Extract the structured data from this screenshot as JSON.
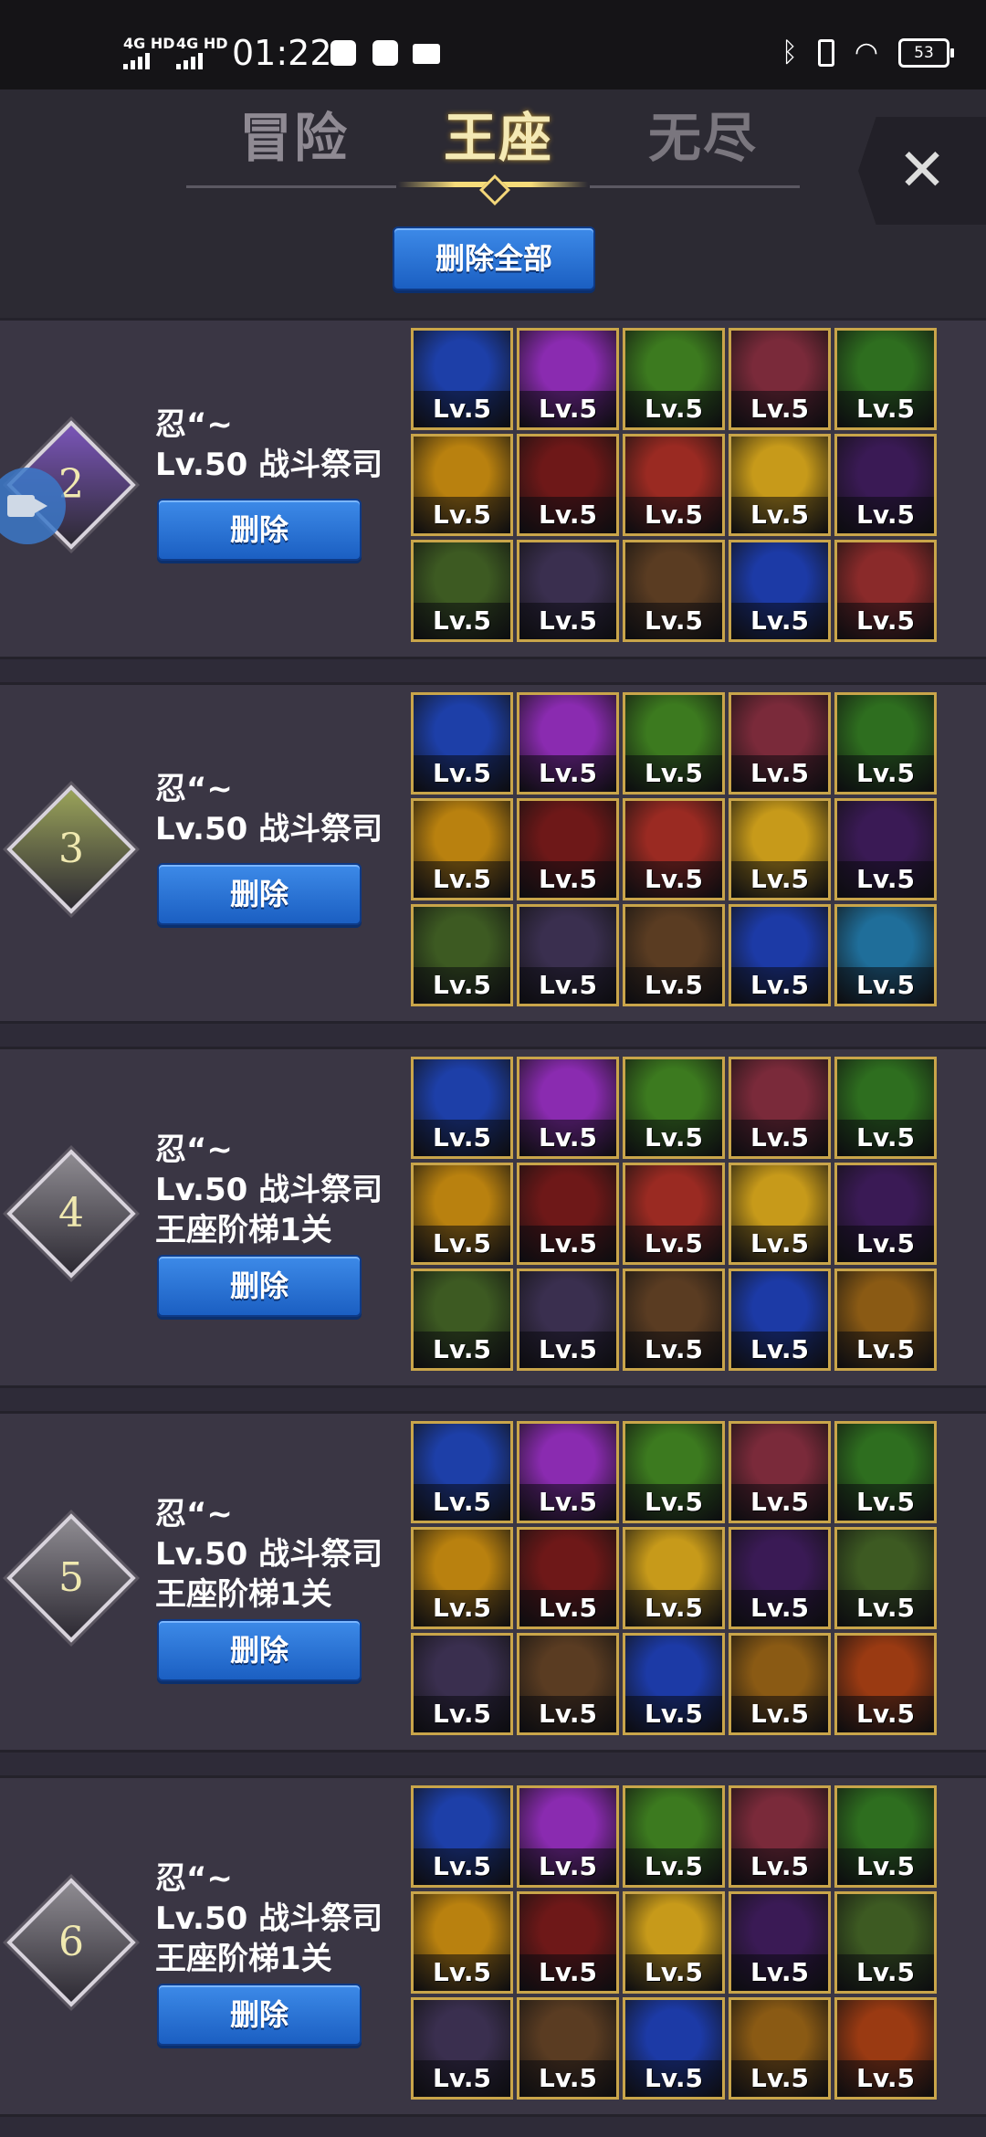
{
  "status_bar": {
    "net1": "4G HD",
    "net2": "4G HD",
    "time": "01:22",
    "battery": "53"
  },
  "header": {
    "tabs": [
      {
        "label": "冒险",
        "active": false
      },
      {
        "label": "王座",
        "active": true
      },
      {
        "label": "无尽",
        "active": false
      }
    ],
    "close_label": "✕",
    "delete_all_label": "删除全部"
  },
  "rows": [
    {
      "rank": "2",
      "rank_color": "#7a55b8",
      "name": "忍“~",
      "level_class": "Lv.50 战斗祭司",
      "stage": "",
      "delete_label": "删除",
      "skills": [
        "Lv.5",
        "Lv.5",
        "Lv.5",
        "Lv.5",
        "Lv.5",
        "Lv.5",
        "Lv.5",
        "Lv.5",
        "Lv.5",
        "Lv.5",
        "Lv.5",
        "Lv.5",
        "Lv.5",
        "Lv.5",
        "Lv.5"
      ],
      "skill_icons": [
        "#1d3fa8",
        "#8a2bb0",
        "#3c7a1f",
        "#7a2a3a",
        "#2e6e1f",
        "#b9810f",
        "#6e1818",
        "#9a2a22",
        "#c79a1a",
        "#3a1a55",
        "#3d5a22",
        "#3a2f4f",
        "#5a3c22",
        "#1c3aa6",
        "#8a2a2a"
      ]
    },
    {
      "rank": "3",
      "rank_color": "#9aa35a",
      "name": "忍“~",
      "level_class": "Lv.50 战斗祭司",
      "stage": "",
      "delete_label": "删除",
      "skills": [
        "Lv.5",
        "Lv.5",
        "Lv.5",
        "Lv.5",
        "Lv.5",
        "Lv.5",
        "Lv.5",
        "Lv.5",
        "Lv.5",
        "Lv.5",
        "Lv.5",
        "Lv.5",
        "Lv.5",
        "Lv.5",
        "Lv.5"
      ],
      "skill_icons": [
        "#1d3fa8",
        "#8a2bb0",
        "#3c7a1f",
        "#7a2a3a",
        "#2e6e1f",
        "#b9810f",
        "#6e1818",
        "#9a2a22",
        "#c79a1a",
        "#3a1a55",
        "#3d5a22",
        "#3a2f4f",
        "#5a3c22",
        "#1c3aa6",
        "#1f6e9a"
      ]
    },
    {
      "rank": "4",
      "rank_color": "#8e8b91",
      "name": "忍“~",
      "level_class": "Lv.50 战斗祭司",
      "stage": "王座阶梯1关",
      "delete_label": "删除",
      "skills": [
        "Lv.5",
        "Lv.5",
        "Lv.5",
        "Lv.5",
        "Lv.5",
        "Lv.5",
        "Lv.5",
        "Lv.5",
        "Lv.5",
        "Lv.5",
        "Lv.5",
        "Lv.5",
        "Lv.5",
        "Lv.5",
        "Lv.5"
      ],
      "skill_icons": [
        "#1d3fa8",
        "#8a2bb0",
        "#3c7a1f",
        "#7a2a3a",
        "#2e6e1f",
        "#b9810f",
        "#6e1818",
        "#9a2a22",
        "#c79a1a",
        "#3a1a55",
        "#3d5a22",
        "#3a2f4f",
        "#5a3c22",
        "#1c3aa6",
        "#8a5a14"
      ]
    },
    {
      "rank": "5",
      "rank_color": "#8e8b91",
      "name": "忍“~",
      "level_class": "Lv.50 战斗祭司",
      "stage": "王座阶梯1关",
      "delete_label": "删除",
      "skills": [
        "Lv.5",
        "Lv.5",
        "Lv.5",
        "Lv.5",
        "Lv.5",
        "Lv.5",
        "Lv.5",
        "Lv.5",
        "Lv.5",
        "Lv.5",
        "Lv.5",
        "Lv.5",
        "Lv.5",
        "Lv.5",
        "Lv.5"
      ],
      "skill_icons": [
        "#1d3fa8",
        "#8a2bb0",
        "#3c7a1f",
        "#7a2a3a",
        "#2e6e1f",
        "#b9810f",
        "#6e1818",
        "#c79a1a",
        "#3a1a55",
        "#3d5a22",
        "#3a2f4f",
        "#5a3c22",
        "#1c3aa6",
        "#8a5a14",
        "#9a3a12"
      ]
    },
    {
      "rank": "6",
      "rank_color": "#8e8b91",
      "name": "忍“~",
      "level_class": "Lv.50 战斗祭司",
      "stage": "王座阶梯1关",
      "delete_label": "删除",
      "skills": [
        "Lv.5",
        "Lv.5",
        "Lv.5",
        "Lv.5",
        "Lv.5",
        "Lv.5",
        "Lv.5",
        "Lv.5",
        "Lv.5",
        "Lv.5",
        "Lv.5",
        "Lv.5",
        "Lv.5",
        "Lv.5",
        "Lv.5"
      ],
      "skill_icons": [
        "#1d3fa8",
        "#8a2bb0",
        "#3c7a1f",
        "#7a2a3a",
        "#2e6e1f",
        "#b9810f",
        "#6e1818",
        "#c79a1a",
        "#3a1a55",
        "#3d5a22",
        "#3a2f4f",
        "#5a3c22",
        "#1c3aa6",
        "#8a5a14",
        "#9a3a12"
      ]
    }
  ]
}
